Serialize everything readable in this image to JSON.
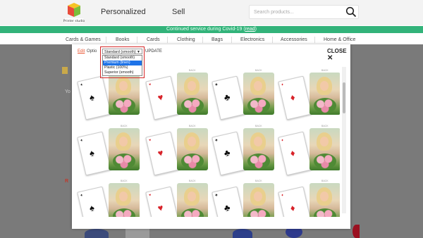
{
  "header": {
    "nav": [
      "Personalized",
      "Sell"
    ],
    "search_placeholder": "Search products..."
  },
  "banner": {
    "text": "Continued service during Covid-19 (",
    "link": "read",
    "end": ")"
  },
  "categories": [
    "Cards & Games",
    "Books",
    "Cards",
    "Clothing",
    "Bags",
    "Electronics",
    "Accessories",
    "Home & Office"
  ],
  "background": {
    "left_text_1": "Yo",
    "left_text_2": "R"
  },
  "modal": {
    "edit_label": "Edit",
    "options_label": "Optio",
    "selected_option": "Standard (smooth)",
    "update_label": "UPDATE",
    "close_label": "CLOSE",
    "dropdown_options": [
      "Standard (smooth)",
      "Premium (linen)",
      "Plastic (100%)",
      "Superior (smooth)"
    ],
    "highlighted_option": "Premium (linen)",
    "back_label": "BACK",
    "suits_row1": [
      "spade",
      "heart",
      "club",
      "diamond"
    ],
    "suits_row2": [
      "spade",
      "heart",
      "club",
      "diamond"
    ],
    "suits_row3": [
      "spade",
      "heart",
      "club",
      "diamond"
    ]
  },
  "colors": {
    "banner": "#32b37a",
    "accent": "#e8502b",
    "highlight_border": "#d42525",
    "select_blue": "#1e73e8"
  }
}
